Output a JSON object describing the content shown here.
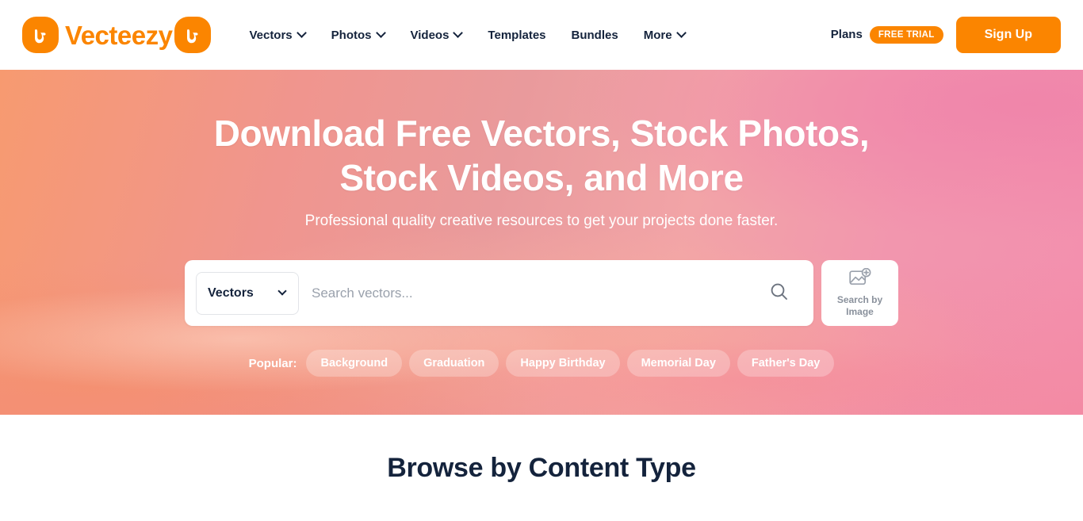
{
  "header": {
    "logo": {
      "word": "Vecteezy",
      "left_badge_icon": "vecteezy-mark-icon",
      "right_badge_icon": "vecteezy-mark-icon"
    },
    "nav": [
      {
        "label": "Vectors",
        "has_chevron": true,
        "name": "nav-item-vectors"
      },
      {
        "label": "Photos",
        "has_chevron": true,
        "name": "nav-item-photos"
      },
      {
        "label": "Videos",
        "has_chevron": true,
        "name": "nav-item-videos"
      },
      {
        "label": "Templates",
        "has_chevron": false,
        "name": "nav-item-templates"
      },
      {
        "label": "Bundles",
        "has_chevron": false,
        "name": "nav-item-bundles"
      },
      {
        "label": "More",
        "has_chevron": true,
        "name": "nav-item-more"
      }
    ],
    "plans_label": "Plans",
    "free_trial_badge": "FREE TRIAL",
    "signup_label": "Sign Up"
  },
  "hero": {
    "title_line1": "Download Free Vectors, Stock Photos,",
    "title_line2": "Stock Videos, and More",
    "subtitle": "Professional quality creative resources to get your projects done faster.",
    "search": {
      "type_value": "Vectors",
      "placeholder": "Search vectors...",
      "input_value": "",
      "search_icon": "search-icon",
      "search_by_image_icon": "image-add-icon",
      "search_by_image_line1": "Search by",
      "search_by_image_line2": "Image"
    },
    "popular": {
      "label": "Popular:",
      "tags": [
        "Background",
        "Graduation",
        "Happy Birthday",
        "Memorial Day",
        "Father's Day"
      ]
    }
  },
  "browse": {
    "title": "Browse by Content Type"
  },
  "colors": {
    "brand_orange": "#FB8500",
    "ink": "#14233C",
    "hero_left": "#F79A70",
    "hero_right": "#F38FAE",
    "muted": "#8A919C"
  }
}
